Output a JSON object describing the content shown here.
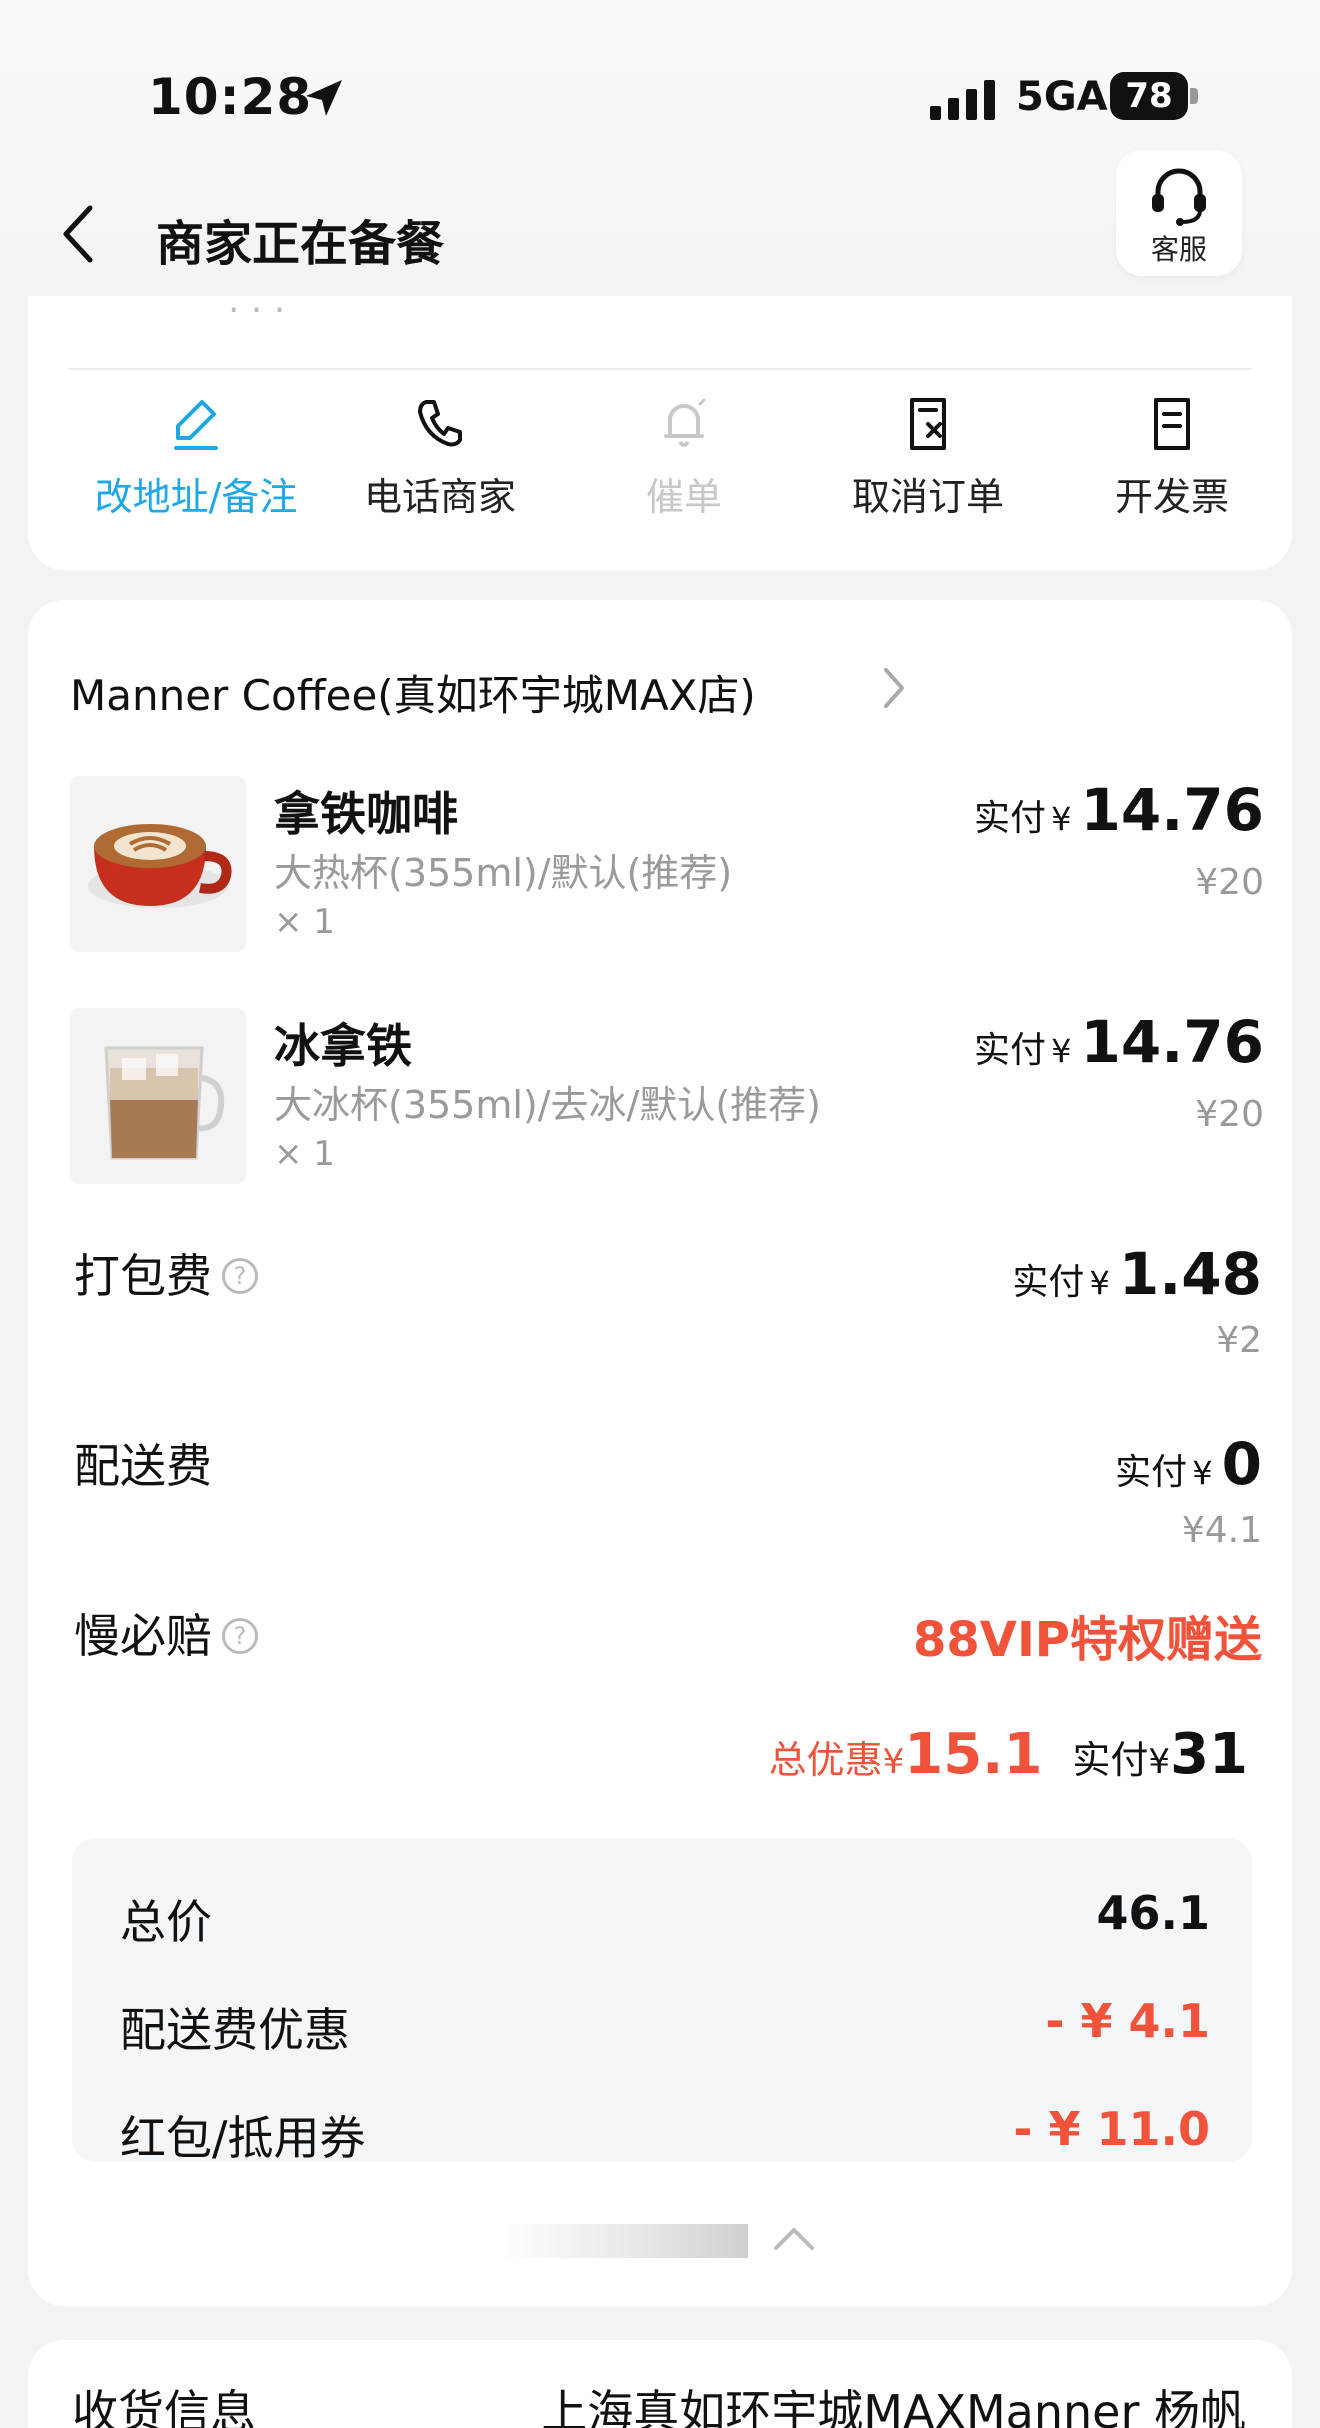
{
  "status_bar": {
    "time": "10:28",
    "network": "5GA",
    "battery": "78"
  },
  "nav": {
    "title": "商家正在备餐",
    "service_label": "客服"
  },
  "actions": [
    {
      "label": "改地址/备注",
      "icon": "edit-icon",
      "state": "active"
    },
    {
      "label": "电话商家",
      "icon": "phone-icon",
      "state": "normal"
    },
    {
      "label": "催单",
      "icon": "bell-icon",
      "state": "disabled"
    },
    {
      "label": "取消订单",
      "icon": "cancel-doc-icon",
      "state": "normal"
    },
    {
      "label": "开发票",
      "icon": "invoice-icon",
      "state": "normal"
    }
  ],
  "order": {
    "shop_name": "Manner Coffee(真如环宇城MAX店)",
    "items": [
      {
        "name": "拿铁咖啡",
        "spec": "大热杯(355ml)/默认(推荐)",
        "qty": "× 1",
        "pay_label": "实付",
        "currency": "¥",
        "pay_value": "14.76",
        "original": "¥20",
        "thumb": "hot-latte-image"
      },
      {
        "name": "冰拿铁",
        "spec": "大冰杯(355ml)/去冰/默认(推荐)",
        "qty": "× 1",
        "pay_label": "实付",
        "currency": "¥",
        "pay_value": "14.76",
        "original": "¥20",
        "thumb": "iced-latte-image"
      }
    ],
    "fees": {
      "packing": {
        "label": "打包费",
        "pay_label": "实付",
        "currency": "¥",
        "pay_value": "1.48",
        "original": "¥2"
      },
      "delivery": {
        "label": "配送费",
        "pay_label": "实付",
        "currency": "¥",
        "pay_value": "0",
        "original": "¥4.1"
      },
      "late": {
        "label": "慢必赔",
        "value": "88VIP特权赠送"
      }
    },
    "totals": {
      "discount_label": "总优惠",
      "discount_currency": "¥",
      "discount_value": "15.1",
      "pay_label": "实付",
      "pay_currency": "¥",
      "pay_value": "31"
    },
    "summary": [
      {
        "label": "总价",
        "value": "46.1",
        "color": "#111111"
      },
      {
        "label": "配送费优惠",
        "value": "- ¥ 4.1",
        "color": "#f0533a"
      },
      {
        "label": "红包/抵用券",
        "value": "- ¥ 11.0",
        "color": "#f0533a"
      }
    ]
  },
  "delivery_info": {
    "label": "收货信息",
    "value": "上海真如环宇城MAXManner 杨帆"
  },
  "colors": {
    "accent": "#1fa8e8",
    "discount_red": "#f0533a",
    "summary_bg": "#f4f7fa"
  }
}
